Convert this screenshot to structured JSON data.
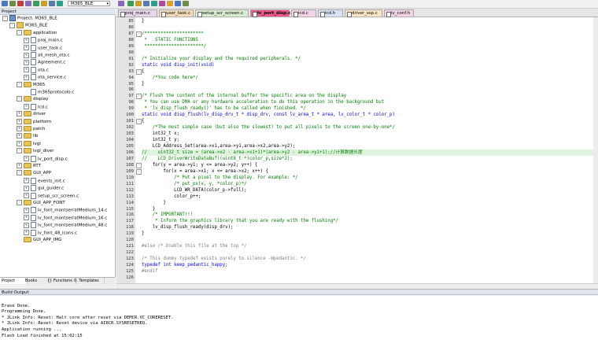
{
  "toolbar": {
    "target": "M365_BLE",
    "button_colors": [
      "#4a78c2",
      "#6c8e4a",
      "#c04040",
      "#8a6ab8",
      "#3c9c5a",
      "#c8a030",
      "#5a7ab0",
      "#2f9e8a",
      "#b04a9a",
      "#e0a030"
    ]
  },
  "project_panel": {
    "title": "Project",
    "tree": [
      {
        "label": "Project: M365_BLE",
        "icon": "project-icon",
        "depth": 0,
        "expander": "-"
      },
      {
        "label": "M365_BLE",
        "icon": "target-icon",
        "depth": 1,
        "expander": "-"
      },
      {
        "label": "application",
        "icon": "folder-icon",
        "depth": 2,
        "expander": "-"
      },
      {
        "label": "proj_main.c",
        "icon": "c-file-icon",
        "depth": 3,
        "expander": "+"
      },
      {
        "label": "user_task.c",
        "icon": "c-file-icon",
        "depth": 3,
        "expander": "+"
      },
      {
        "label": "ali_mesh_ota.c",
        "icon": "c-file-icon",
        "depth": 3,
        "expander": "+"
      },
      {
        "label": "Agreement.c",
        "icon": "c-file-icon",
        "depth": 3,
        "expander": "+"
      },
      {
        "label": "ota.c",
        "icon": "c-file-icon",
        "depth": 3,
        "expander": "+"
      },
      {
        "label": "ota_service.c",
        "icon": "c-file-icon",
        "depth": 3,
        "expander": "+"
      },
      {
        "label": "M365",
        "icon": "folder-icon",
        "depth": 2,
        "expander": "-"
      },
      {
        "label": "m365protocolo.c",
        "icon": "c-file-icon",
        "depth": 3,
        "expander": ""
      },
      {
        "label": "display",
        "icon": "folder-icon",
        "depth": 2,
        "expander": "-"
      },
      {
        "label": "lcd.c",
        "icon": "c-file-icon",
        "depth": 3,
        "expander": "+"
      },
      {
        "label": "driver",
        "icon": "folder-icon",
        "depth": 2,
        "expander": "+"
      },
      {
        "label": "platform",
        "icon": "folder-icon",
        "depth": 2,
        "expander": "+"
      },
      {
        "label": "patch",
        "icon": "folder-icon",
        "depth": 2,
        "expander": "+"
      },
      {
        "label": "lib",
        "icon": "folder-icon",
        "depth": 2,
        "expander": "+"
      },
      {
        "label": "lvgl",
        "icon": "folder-icon",
        "depth": 2,
        "expander": "+"
      },
      {
        "label": "lvgl_diver",
        "icon": "folder-icon",
        "depth": 2,
        "expander": "-"
      },
      {
        "label": "lv_port_disp.c",
        "icon": "c-file-icon",
        "depth": 3,
        "expander": "+"
      },
      {
        "label": "RTT",
        "icon": "folder-icon",
        "depth": 2,
        "expander": "+"
      },
      {
        "label": "GUI_APP",
        "icon": "folder-icon",
        "depth": 2,
        "expander": "-"
      },
      {
        "label": "events_init.c",
        "icon": "c-file-icon",
        "depth": 3,
        "expander": "+"
      },
      {
        "label": "gui_guider.c",
        "icon": "c-file-icon",
        "depth": 3,
        "expander": "+"
      },
      {
        "label": "setup_scr_screen.c",
        "icon": "c-file-icon",
        "depth": 3,
        "expander": "+"
      },
      {
        "label": "GUI_APP_FONT",
        "icon": "folder-icon",
        "depth": 2,
        "expander": "-"
      },
      {
        "label": "lv_font_montserratMedium_14.c",
        "icon": "c-file-icon",
        "depth": 3,
        "expander": "+"
      },
      {
        "label": "lv_font_montserratMedium_16.c",
        "icon": "c-file-icon",
        "depth": 3,
        "expander": "+"
      },
      {
        "label": "lv_font_montserratMedium_48.c",
        "icon": "c-file-icon",
        "depth": 3,
        "expander": "+"
      },
      {
        "label": "lv_font_48_icons.c",
        "icon": "c-file-icon",
        "depth": 3,
        "expander": "+"
      },
      {
        "label": "GUI_APP_IMG",
        "icon": "folder-icon",
        "depth": 2,
        "expander": ""
      }
    ],
    "tabs": [
      "Project",
      "Books",
      "{} Functions",
      "0. Templates"
    ]
  },
  "editor_tabs": [
    {
      "label": "proj_main.c",
      "color": "#e9d6ea"
    },
    {
      "label": "user_task.c",
      "color": "#f5dcb8"
    },
    {
      "label": "setup_scr_screen.c",
      "color": "#d8ecd0"
    },
    {
      "label": "lv_port_disp.c",
      "color": "#f05a8c",
      "active": true
    },
    {
      "label": "lcd.c",
      "color": "#f2d4e6"
    },
    {
      "label": "lcd.h",
      "color": "#d6e4f4"
    },
    {
      "label": "driver_ssp.c",
      "color": "#f8e6c4"
    },
    {
      "label": "lv_conf.h",
      "color": "#f2d4e6"
    }
  ],
  "editor": {
    "lines": [
      {
        "n": "85",
        "text": "}",
        "cls": "c-txt"
      },
      {
        "n": "86",
        "text": "",
        "cls": "c-txt"
      },
      {
        "n": "87",
        "fold": "-",
        "text": "/**********************",
        "cls": "c-com"
      },
      {
        "n": "88",
        "text": " *   STATIC FUNCTIONS",
        "cls": "c-com"
      },
      {
        "n": "89",
        "text": " **********************/",
        "cls": "c-com"
      },
      {
        "n": "90",
        "text": "",
        "cls": "c-txt"
      },
      {
        "n": "91",
        "text": "/* Initialize your display and the required peripherals. */",
        "cls": "c-com"
      },
      {
        "n": "92",
        "text": "static void disp_init(void)",
        "cls": "c-kw"
      },
      {
        "n": "93",
        "fold": "-",
        "text": "{",
        "cls": "c-txt"
      },
      {
        "n": "94",
        "text": "    /*You code here*/",
        "cls": "c-com"
      },
      {
        "n": "95",
        "text": "}",
        "cls": "c-txt"
      },
      {
        "n": "96",
        "text": "",
        "cls": "c-txt"
      },
      {
        "n": "97",
        "fold": "-",
        "text": "/* Flush the content of the internal buffer the specific area on the display",
        "cls": "c-com"
      },
      {
        "n": "98",
        "text": " * You can use DMA or any hardware acceleration to do this operation in the background but",
        "cls": "c-com"
      },
      {
        "n": "99",
        "text": " * 'lv_disp_flush_ready()' has to be called when finished. */",
        "cls": "c-com"
      },
      {
        "n": "100",
        "text": "static void disp_flush(lv_disp_drv_t * disp_drv, const lv_area_t * area, lv_color_t * color_p)",
        "cls": "c-kw"
      },
      {
        "n": "101",
        "fold": "-",
        "text": "{",
        "cls": "c-txt"
      },
      {
        "n": "102",
        "text": "    /*The most simple case (but also the slowest) to put all pixels to the screen one-by-one*/",
        "cls": "c-com"
      },
      {
        "n": "103",
        "text": "    int32_t x;",
        "cls": "c-txt"
      },
      {
        "n": "104",
        "text": "    int32_t y;",
        "cls": "c-txt"
      },
      {
        "n": "105",
        "text": "    LCD_Address_Set(area->x1,area->y1,area->x2,area->y2);",
        "cls": "c-txt"
      },
      {
        "n": "106",
        "text": "//    uint32_t size = (area->x2 - area->x1+1)*(area->y2 - area->y1+1);//计算数据长度",
        "cls": "c-com",
        "hl": true
      },
      {
        "n": "107",
        "text": "//    LCD_DriverWriteDataBuf((uint8_t *)color_p,size*2);",
        "cls": "c-com"
      },
      {
        "n": "108",
        "fold": "-",
        "text": "    for(y = area->y1; y <= area->y2; y++) {",
        "cls": "c-txt"
      },
      {
        "n": "109",
        "fold": "-",
        "text": "        for(x = area->x1; x <= area->x2; x++) {",
        "cls": "c-txt"
      },
      {
        "n": "110",
        "text": "            /* Put a pixel to the display. For example: */",
        "cls": "c-com"
      },
      {
        "n": "111",
        "text": "            /* put_px(x, y, *color_p)*/",
        "cls": "c-com"
      },
      {
        "n": "112",
        "text": "            LCD_WR_DATA(color_p->full);",
        "cls": "c-txt"
      },
      {
        "n": "113",
        "text": "            color_p++;",
        "cls": "c-txt"
      },
      {
        "n": "114",
        "text": "        }",
        "cls": "c-txt"
      },
      {
        "n": "115",
        "text": "    }",
        "cls": "c-txt"
      },
      {
        "n": "116",
        "text": "    /* IMPORTANT!!!",
        "cls": "c-com"
      },
      {
        "n": "117",
        "text": "     * Inform the graphics library that you are ready with the flushing*/",
        "cls": "c-com"
      },
      {
        "n": "118",
        "text": "    lv_disp_flush_ready(disp_drv);",
        "cls": "c-txt"
      },
      {
        "n": "119",
        "text": "}",
        "cls": "c-txt"
      },
      {
        "n": "120",
        "text": "",
        "cls": "c-txt"
      },
      {
        "n": "121",
        "text": "#else /* Enable this file at the top */",
        "cls": "c-pp"
      },
      {
        "n": "122",
        "text": "",
        "cls": "c-txt"
      },
      {
        "n": "123",
        "text": "/* This dummy typedef exists purely to silence -Wpedantic. */",
        "cls": "c-pp"
      },
      {
        "n": "124",
        "text": "typedef int keep_pedantic_happy;",
        "cls": "c-kw"
      },
      {
        "n": "125",
        "text": "#endif",
        "cls": "c-pp"
      },
      {
        "n": "126",
        "text": "",
        "cls": "c-txt"
      }
    ]
  },
  "build_output": {
    "title": "Build Output",
    "lines": [
      "",
      "Erase Done.",
      "Programming Done.",
      "* JLink Info: Reset: Halt core after reset via DEMCR.VC_CORERESET.",
      "* JLink Info: Reset: Reset device via AIRCR.SYSRESETREQ.",
      "Application running ...",
      "Flash Load finished at 15:02:15"
    ]
  }
}
